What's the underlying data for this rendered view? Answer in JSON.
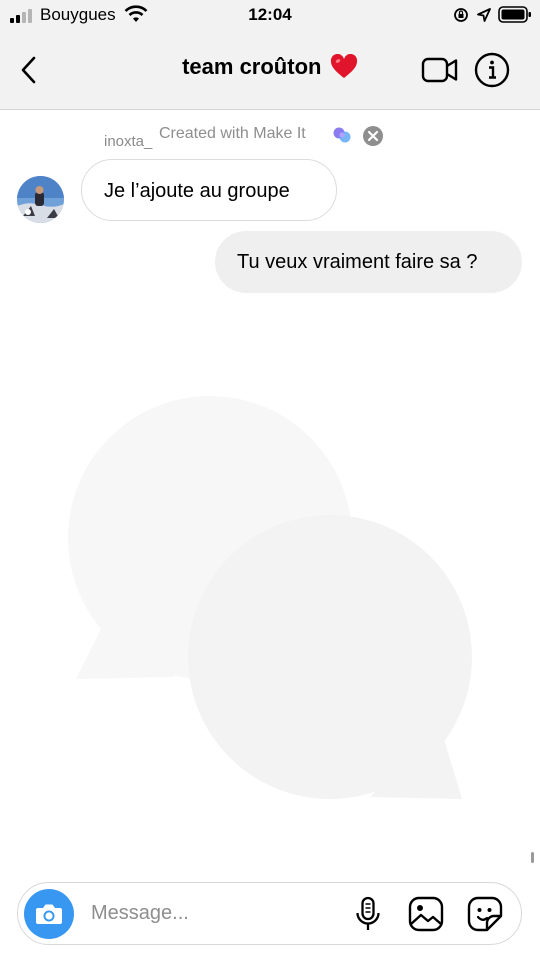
{
  "status_bar": {
    "carrier": "Bouygues",
    "time": "12:04",
    "icons": [
      "signal-icon",
      "wifi-icon",
      "orientation-lock-icon",
      "location-icon",
      "battery-icon"
    ]
  },
  "header": {
    "title": "team croûton",
    "title_emoji": "heart-icon",
    "back_icon": "chevron-left-icon",
    "actions": [
      "video-call-icon",
      "info-icon"
    ]
  },
  "made_with": {
    "username": "inoxta_",
    "text": "Created with Make It",
    "logo_icon": "make-it-logo-icon",
    "close_icon": "close-circle-icon"
  },
  "messages": [
    {
      "direction": "received",
      "text": "Je l’ajoute au groupe",
      "has_avatar": true
    },
    {
      "direction": "sent",
      "text": "Tu veux vraiment faire sa ?"
    }
  ],
  "composer": {
    "placeholder": "Message...",
    "value": "",
    "icons": [
      "camera-icon",
      "microphone-icon",
      "gallery-icon",
      "sticker-icon"
    ]
  },
  "colors": {
    "header_bg": "#f2f2f2",
    "camera_button": "#3897f0",
    "sent_bubble": "#efefef",
    "received_border": "#dcdcdc",
    "muted_text": "#8e8e8e",
    "heart": "#e0142b"
  }
}
